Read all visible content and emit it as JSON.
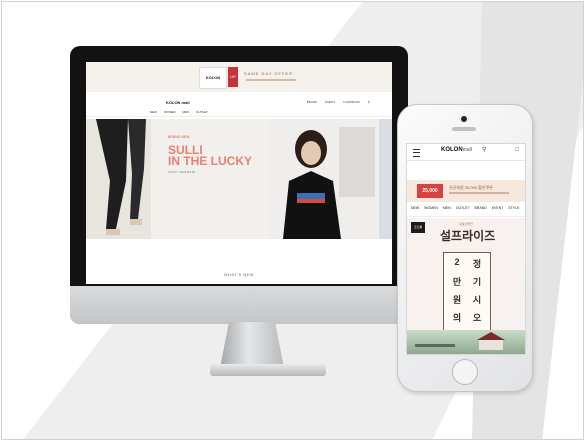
{
  "desktop": {
    "top_logo": "KOLON",
    "top_badge": "UP",
    "top_promo": "SAME DAY OFFER",
    "brand": "KOLON mall",
    "nav": [
      "NEW",
      "WOMEN",
      "MEN",
      "OUTLET"
    ],
    "util": [
      "BRAND",
      "EVENT",
      "LOOKBOOK"
    ],
    "hero_tag": "BRAND NEW",
    "hero_title_line1": "SULLI",
    "hero_title_line2": "IN THE LUCKY",
    "hero_sub": "LUCKY CHOUETTE",
    "whats_new": "WHAT'S NEW"
  },
  "mobile": {
    "logo_main": "KOLON",
    "logo_sub": "mall",
    "badge": "25,000",
    "banner_text": "신규회원 25,000 할인쿠폰",
    "nav": [
      "NEW",
      "WOMEN",
      "MEN",
      "OUTLET",
      "BRAND",
      "EVENT",
      "STYLE"
    ],
    "event_tag": "코오롱",
    "event_small": "설날선물전",
    "event_title": "설프라이즈",
    "grid_chars": [
      "2",
      "정",
      "만",
      "기",
      "원",
      "시",
      "의",
      "오"
    ]
  },
  "colors": {
    "accent": "#e9806e",
    "badge_red": "#d8413d"
  }
}
